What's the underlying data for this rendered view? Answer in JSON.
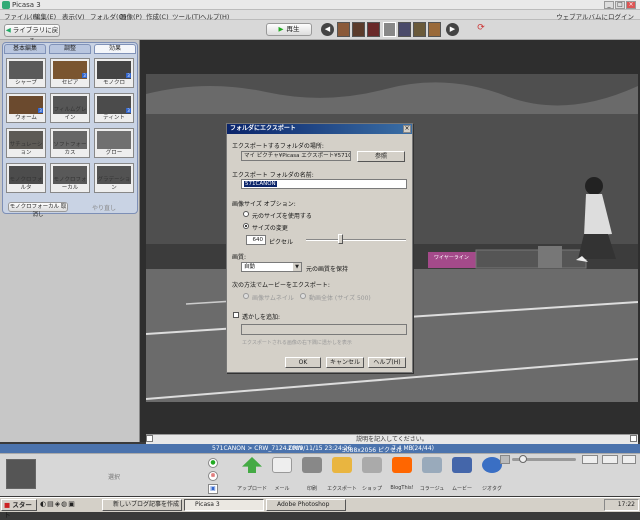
{
  "app": {
    "title": "Picasa 3",
    "signin": "ウェブアルバムにログイン"
  },
  "window_controls": [
    "_",
    "□",
    "×"
  ],
  "menu": [
    "ファイル(F)",
    "編集(E)",
    "表示(V)",
    "フォルダ(O)",
    "画像(P)",
    "作成(C)",
    "ツール(T)",
    "ヘルプ(H)"
  ],
  "toolbar": {
    "back": "ライブラリに戻る",
    "play": "再生"
  },
  "left_panel": {
    "tabs": [
      "基本編集",
      "調整",
      "効果"
    ],
    "effects": [
      "シャープ",
      "セピア",
      "モノクロ",
      "ウォーム",
      "フィルムグレイン",
      "ティント",
      "サチュレーション",
      "ソフトフォーカス",
      "グロー",
      "モノクロフォルタ",
      "モノクロフォーカル",
      "グラデーション"
    ],
    "bw_button": "モノクロフォーカル 取消し",
    "redo": "やり直し"
  },
  "caption": "説明を記入してください。",
  "status": {
    "path": "571CANON > CRW_7124.CRW",
    "date": "2009/11/15 23:24:26",
    "size": "3088x2056 ピクセル",
    "filesize": "7.4 MB",
    "count": "(24/44)"
  },
  "tray": {
    "label": "選択"
  },
  "bottom_buttons": [
    "アップロード",
    "メール",
    "印刷",
    "エクスポート",
    "ショップ",
    "BlogThis!",
    "コラージュ",
    "ムービー",
    "ジオタグ"
  ],
  "taskbar": {
    "start": "スタート",
    "tasks": [
      "新しいブログ記事を作成 -...",
      "Picasa 3",
      "Adobe Photoshop"
    ],
    "clock": "17:22"
  },
  "photo_sign": "ワイヤーライン",
  "dialog": {
    "title": "フォルダにエクスポート",
    "location_label": "エクスポートするフォルダの場所:",
    "location_value": "マイ ピクチャ¥Picasa エクスポート¥571CANON¥",
    "browse": "参照",
    "name_label": "エクスポート フォルダの名前:",
    "name_value": "571CANON",
    "size_label": "画像サイズ オプション:",
    "size_orig": "元のサイズを使用する",
    "size_resize": "サイズの変更",
    "pixels_value": "640",
    "pixels_unit": "ピクセル",
    "quality_label": "画質:",
    "quality_value": "自動",
    "quality_note": "元の画質を保持",
    "movie_label": "次の方法でムービーをエクスポート:",
    "movie_opt1": "画像サムネイル",
    "movie_opt2": "動画全体 (サイズ 500)",
    "watermark_label": "透かしを追加:",
    "watermark_hint": "エクスポートされる画像の右下隅に透かしを表示",
    "ok": "OK",
    "cancel": "キャンセル",
    "help": "ヘルプ(H)"
  }
}
